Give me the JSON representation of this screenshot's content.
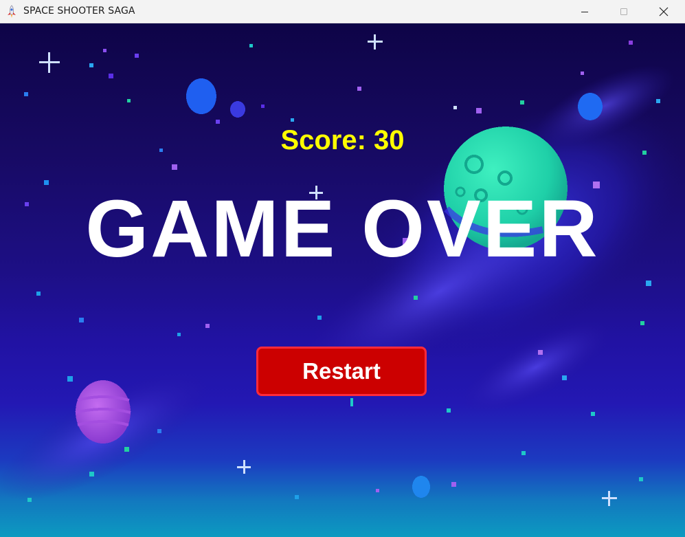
{
  "window": {
    "title": "SPACE SHOOTER SAGA",
    "app_icon": "rocket-icon",
    "controls": [
      "minimize-icon",
      "maximize-icon",
      "close-icon"
    ]
  },
  "game": {
    "score_text": "Score: 30",
    "game_over_text": "GAME OVER",
    "restart_label": "Restart"
  },
  "colors": {
    "score": "#ffff00",
    "game_over": "#ffffff",
    "restart_bg": "#cc0000",
    "restart_border": "#ff2a3a",
    "sky_top": "#0e0447",
    "sky_bottom": "#0c9ac0"
  }
}
